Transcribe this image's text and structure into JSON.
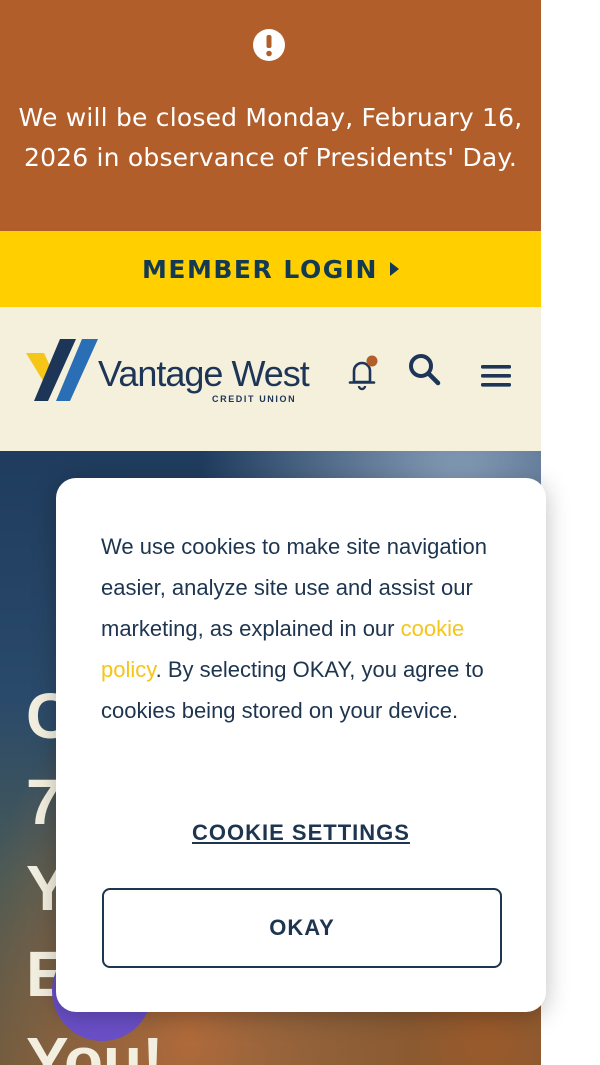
{
  "alert": {
    "icon": "exclamation-circle-icon",
    "message": "We will be closed Monday, February 16, 2026 in observance of Presidents' Day."
  },
  "login_bar": {
    "label": "MEMBER LOGIN",
    "icon": "caret-right-icon"
  },
  "header": {
    "logo_name": "Vantage West",
    "logo_tagline": "CREDIT UNION",
    "icons": [
      "bell-icon",
      "search-icon",
      "hamburger-menu-icon"
    ],
    "notification_dot_color": "#b15e2b"
  },
  "hero": {
    "title": "C\n7\nY\nE\nYou!"
  },
  "cookie_banner": {
    "text_before": "We use cookies to make site navigation easier, analyze site use and assist our marketing, as explained in our ",
    "link_text": "cookie policy",
    "text_after": ". By selecting OKAY, you agree to cookies being stored on your device.",
    "settings_label": "COOKIE SETTINGS",
    "okay_label": "OKAY"
  },
  "colors": {
    "alert_bg": "#b15e2b",
    "login_bg": "#ffcf00",
    "header_bg": "#f5f0dc",
    "navy": "#1e3550",
    "link": "#f5c518",
    "chat_bubble": "#6a4fc7"
  }
}
